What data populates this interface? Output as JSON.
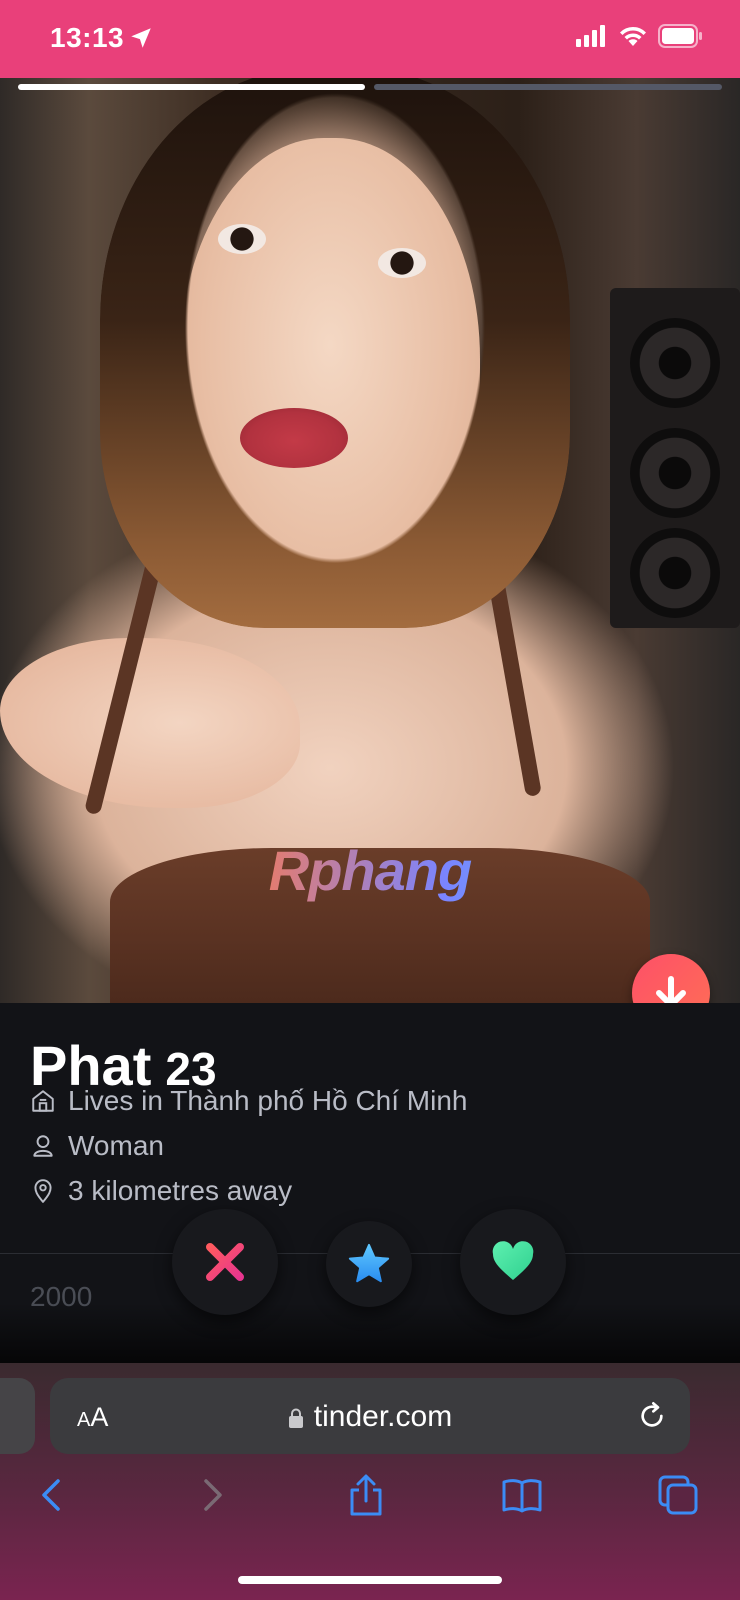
{
  "status_bar": {
    "time": "13:13",
    "background": "#e9407a"
  },
  "photo": {
    "progress": [
      {
        "state": "active"
      },
      {
        "state": "inactive"
      }
    ],
    "watermark": "Rphang",
    "expand_icon": "arrow-down-icon"
  },
  "profile": {
    "name": "Phat",
    "age": "23",
    "lives_in": "Lives in Thành phố Hồ Chí Minh",
    "gender": "Woman",
    "distance": "3 kilometres away",
    "year_text": "2000"
  },
  "actions": [
    {
      "name": "nope",
      "icon": "x-icon",
      "color": "#fd3e6a"
    },
    {
      "name": "super-like",
      "icon": "star-icon",
      "color": "#4fb4ff"
    },
    {
      "name": "like",
      "icon": "heart-icon",
      "color": "#4be1a0"
    }
  ],
  "browser": {
    "aa_label_small": "A",
    "aa_label_large": "A",
    "url": "tinder.com"
  },
  "toolbar": {
    "items": [
      "back-icon",
      "forward-icon",
      "share-icon",
      "bookmarks-icon",
      "tabs-icon"
    ]
  }
}
